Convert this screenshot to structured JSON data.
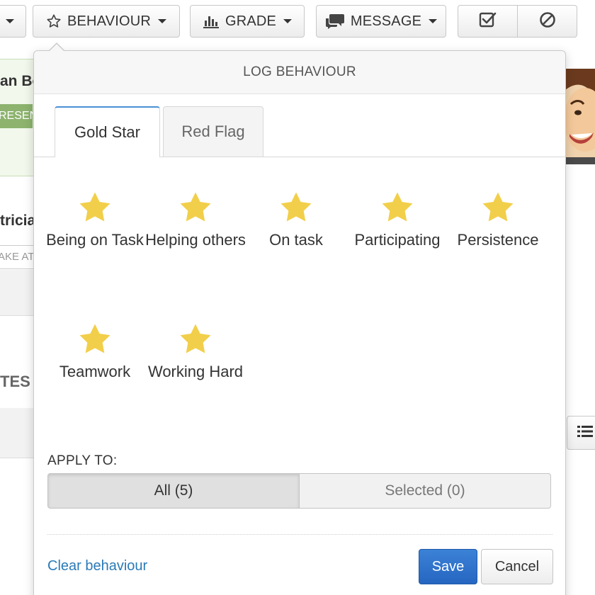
{
  "toolbar": {
    "behaviour_label": "BEHAVIOUR",
    "grade_label": "GRADE",
    "message_label": "MESSAGE"
  },
  "background": {
    "student_name_fragment": "an Bo",
    "present_fragment": "RESEN",
    "name2_fragment": "tricia",
    "take_fragment": "AKE AT",
    "notes_fragment": "TES"
  },
  "popover": {
    "title": "LOG BEHAVIOUR",
    "tabs": [
      {
        "label": "Gold Star",
        "active": true
      },
      {
        "label": "Red Flag",
        "active": false
      }
    ],
    "behaviours": [
      {
        "label": "Being on Task"
      },
      {
        "label": "Helping others"
      },
      {
        "label": "On task"
      },
      {
        "label": "Participating"
      },
      {
        "label": "Persistence"
      },
      {
        "label": "Teamwork"
      },
      {
        "label": "Working Hard"
      }
    ],
    "apply_to_label": "APPLY TO:",
    "apply_options": [
      {
        "label": "All (5)",
        "selected": true
      },
      {
        "label": "Selected (0)",
        "selected": false
      }
    ],
    "clear_label": "Clear behaviour",
    "save_label": "Save",
    "cancel_label": "Cancel"
  },
  "colors": {
    "star": "#f2cf4a",
    "primary": "#2f74cc",
    "link": "#2a7ab8",
    "tab_active_border": "#4a8fd6"
  }
}
